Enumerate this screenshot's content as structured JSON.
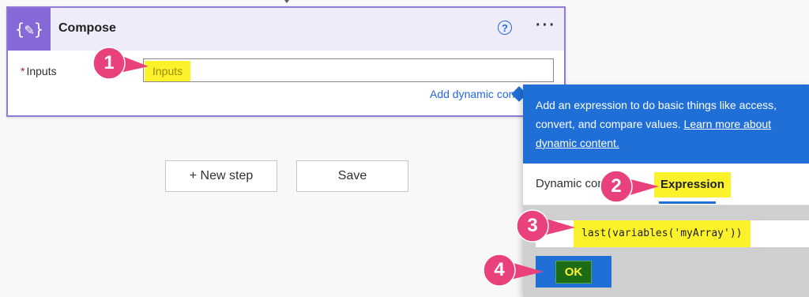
{
  "card": {
    "icon": "compose-icon",
    "title": "Compose",
    "help_icon": "help-icon",
    "more_icon": "more-options-icon",
    "field": {
      "required_mark": "*",
      "label": "Inputs",
      "placeholder": "Inputs"
    },
    "add_dynamic_label": "Add dynamic content"
  },
  "buttons": {
    "new_step": "+ New step",
    "save": "Save"
  },
  "panel": {
    "banner_line1": "Add an expression to do basic things like access,",
    "banner_line2_prefix": "convert, and compare values.",
    "banner_link1": "Learn more about",
    "banner_link2": "dynamic content.",
    "tabs": [
      "Dynamic content",
      "Expression"
    ],
    "active_tab": "Expression",
    "expression_value": "last(variables('myArray'))",
    "ok_label": "OK"
  },
  "callouts": [
    "1",
    "2",
    "3",
    "4"
  ],
  "colors": {
    "accent_blue": "#1f6fd6",
    "callout_pink": "#e9417b",
    "highlight_yellow": "#fbf22b",
    "compose_purple": "#8669d6"
  }
}
